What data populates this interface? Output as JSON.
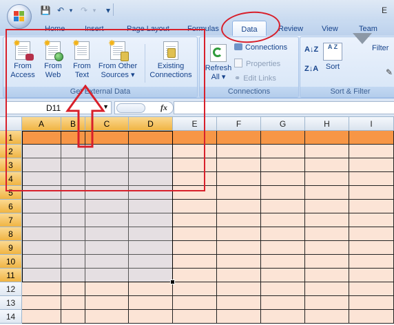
{
  "title_bar": {
    "title_text": "E",
    "quick_access": {
      "save_glyph": "💾",
      "undo_glyph": "↶",
      "redo_glyph": "↷",
      "customize_glyph": "▾"
    }
  },
  "tabs": [
    {
      "label": "Home"
    },
    {
      "label": "Insert"
    },
    {
      "label": "Page Layout"
    },
    {
      "label": "Formulas"
    },
    {
      "label": "Data",
      "active": true
    },
    {
      "label": "Review"
    },
    {
      "label": "View"
    },
    {
      "label": "Team"
    }
  ],
  "ribbon": {
    "get_external_data": {
      "label": "Get External Data",
      "from_access": {
        "line1": "From",
        "line2": "Access"
      },
      "from_web": {
        "line1": "From",
        "line2": "Web"
      },
      "from_text": {
        "line1": "From",
        "line2": "Text"
      },
      "from_other": {
        "line1": "From Other",
        "line2": "Sources ▾"
      },
      "existing": {
        "line1": "Existing",
        "line2": "Connections"
      }
    },
    "connections": {
      "label": "Connections",
      "refresh": {
        "line1": "Refresh",
        "line2": "All ▾"
      },
      "connections": "Connections",
      "properties": "Properties",
      "edit_links": "Edit Links"
    },
    "sort_filter": {
      "label": "Sort & Filter",
      "sort_az": "A↓Z",
      "sort_za": "Z↓A",
      "sort_icon_text": "A Z",
      "sort": "Sort",
      "filter": "Filter"
    }
  },
  "formula_bar": {
    "name_box": "D11",
    "name_box_arrow": "▼",
    "fx": "fx",
    "formula": ""
  },
  "sheet": {
    "columns": [
      "A",
      "B",
      "C",
      "D",
      "E",
      "F",
      "G",
      "H",
      "I"
    ],
    "rows": [
      "1",
      "2",
      "3",
      "4",
      "5",
      "6",
      "7",
      "8",
      "9",
      "10",
      "11",
      "12",
      "13",
      "14"
    ],
    "selected_range": "A1:D11",
    "header_row_color": "#f79646",
    "body_color": "#fce4d6",
    "selection_color": "#e5dfe2"
  },
  "colors": {
    "annotation_red": "#d81f2a",
    "ribbon_text": "#15428b"
  }
}
